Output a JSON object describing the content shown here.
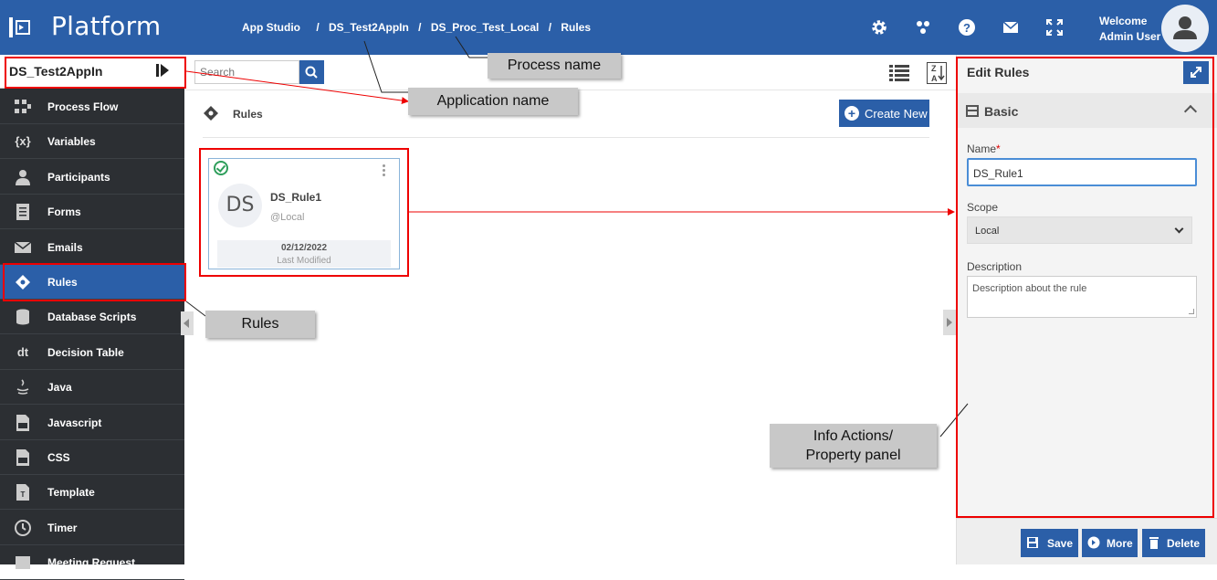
{
  "header": {
    "brand": "Platform",
    "breadcrumbs": [
      "App Studio",
      "DS_Test2AppIn",
      "DS_Proc_Test_Local",
      "Rules"
    ],
    "breadcrumb_sep": "/",
    "icons": [
      "gear-icon",
      "cluster-icon",
      "help-icon",
      "mail-icon",
      "fullscreen-icon"
    ],
    "welcome": "Welcome",
    "user": "Admin User"
  },
  "sidebar": {
    "app_name": "DS_Test2AppIn",
    "items": [
      {
        "label": "Process Flow",
        "icon": "process-flow-icon"
      },
      {
        "label": "Variables",
        "icon": "variables-icon",
        "glyph": "{x}"
      },
      {
        "label": "Participants",
        "icon": "participants-icon"
      },
      {
        "label": "Forms",
        "icon": "forms-icon"
      },
      {
        "label": "Emails",
        "icon": "emails-icon"
      },
      {
        "label": "Rules",
        "icon": "rules-icon",
        "active": true
      },
      {
        "label": "Database Scripts",
        "icon": "database-icon"
      },
      {
        "label": "Decision Table",
        "icon": "decision-table-icon",
        "glyph": "dt"
      },
      {
        "label": "Java",
        "icon": "java-icon"
      },
      {
        "label": "Javascript",
        "icon": "javascript-icon"
      },
      {
        "label": "CSS",
        "icon": "css-icon"
      },
      {
        "label": "Template",
        "icon": "template-icon"
      },
      {
        "label": "Timer",
        "icon": "timer-icon"
      },
      {
        "label": "Meeting Request",
        "icon": "meeting-icon"
      }
    ]
  },
  "main": {
    "search_placeholder": "Search",
    "heading": "Rules",
    "create_label": "Create New",
    "card": {
      "initials": "DS",
      "title": "DS_Rule1",
      "subtitle": "@Local",
      "date": "02/12/2022",
      "date_label": "Last Modified"
    }
  },
  "panel": {
    "title": "Edit Rules",
    "section": "Basic",
    "name_label": "Name",
    "required_mark": "*",
    "name_value": "DS_Rule1",
    "scope_label": "Scope",
    "scope_value": "Local",
    "description_label": "Description",
    "description_value": "Description about the rule",
    "buttons": {
      "save": "Save",
      "more": "More",
      "delete": "Delete"
    }
  },
  "annotations": {
    "process_name": "Process name",
    "application_name": "Application name",
    "rules": "Rules",
    "info_line1": "Info Actions/",
    "info_line2": "Property panel"
  },
  "colors": {
    "primary": "#2b5fa8",
    "sidebar": "#2c2f33",
    "annotation": "#e00000",
    "success": "#2e9e5b"
  }
}
